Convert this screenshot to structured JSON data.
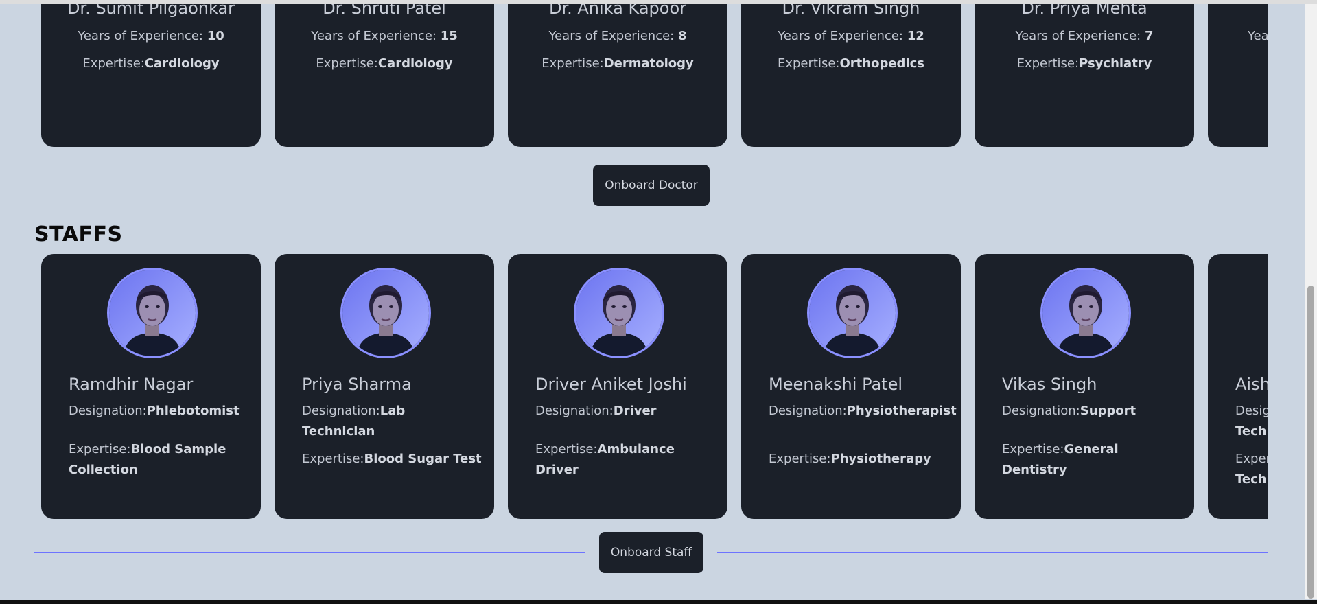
{
  "doctors": [
    {
      "name": "Dr. Sumit Pilgaonkar",
      "exp_label": "Years of Experience: ",
      "exp_value": "10",
      "expertise_label": "Expertise:",
      "expertise": "Cardiology"
    },
    {
      "name": "Dr. Shruti Patel",
      "exp_label": "Years of Experience: ",
      "exp_value": "15",
      "expertise_label": "Expertise:",
      "expertise": "Cardiology"
    },
    {
      "name": "Dr. Anika Kapoor",
      "exp_label": "Years of Experience: ",
      "exp_value": "8",
      "expertise_label": "Expertise:",
      "expertise": "Dermatology"
    },
    {
      "name": "Dr. Vikram Singh",
      "exp_label": "Years of Experience: ",
      "exp_value": "12",
      "expertise_label": "Expertise:",
      "expertise": "Orthopedics"
    },
    {
      "name": "Dr. Priya Mehta",
      "exp_label": "Years of Experience: ",
      "exp_value": "7",
      "expertise_label": "Expertise:",
      "expertise": "Psychiatry"
    },
    {
      "name": "",
      "exp_label": "Yea",
      "exp_value": "",
      "expertise_label": "",
      "expertise": ""
    }
  ],
  "onboard_doctor_label": "Onboard Doctor",
  "staffs_heading": "STAFFS",
  "staffs": [
    {
      "name": "Ramdhir Nagar",
      "designation_label": "Designation:",
      "designation": "Phlebotomist",
      "expertise_label": "Expertise:",
      "expertise": "Blood Sample Collection"
    },
    {
      "name": "Priya Sharma",
      "designation_label": "Designation:",
      "designation": "Lab Technician",
      "expertise_label": "Expertise:",
      "expertise": "Blood Sugar Test"
    },
    {
      "name": "Driver Aniket Joshi",
      "designation_label": "Designation:",
      "designation": "Driver",
      "expertise_label": "Expertise:",
      "expertise": "Ambulance Driver"
    },
    {
      "name": "Meenakshi Patel",
      "designation_label": "Designation:",
      "designation": "Physiotherapist",
      "expertise_label": "Expertise:",
      "expertise": "Physiotherapy"
    },
    {
      "name": "Vikas Singh",
      "designation_label": "Designation:",
      "designation": "Support",
      "expertise_label": "Expertise:",
      "expertise": "General Dentistry"
    },
    {
      "name": "Aish",
      "designation_label": "Desig",
      "designation": "Techn",
      "expertise_label": "Exper",
      "expertise": "Techn"
    }
  ],
  "onboard_staff_label": "Onboard Staff",
  "colors": {
    "accent": "#6d73ff",
    "card": "#1b2029",
    "background": "#cbd5e1",
    "avatar_ring": "#8a90ff"
  }
}
